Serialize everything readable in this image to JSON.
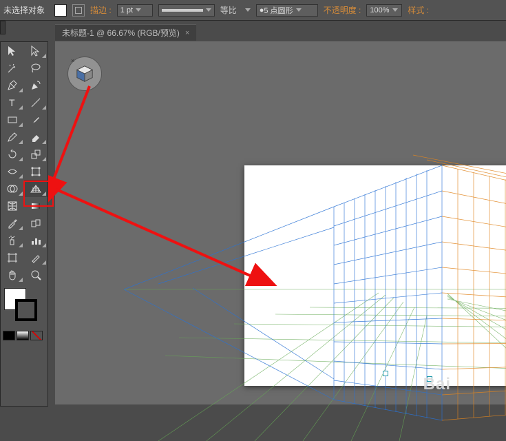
{
  "topbar": {
    "selection_status": "未选择对象",
    "stroke_label": "描边 :",
    "stroke_weight": "1 pt",
    "scale_label": "等比",
    "stroke_profile": "5 点圆形",
    "opacity_label": "不透明度 :",
    "opacity_value": "100%",
    "style_label": "样式 :"
  },
  "document": {
    "tab_title": "未标题-1 @ 66.67% (RGB/预览)",
    "close_glyph": "×"
  },
  "watermark": "Bai"
}
